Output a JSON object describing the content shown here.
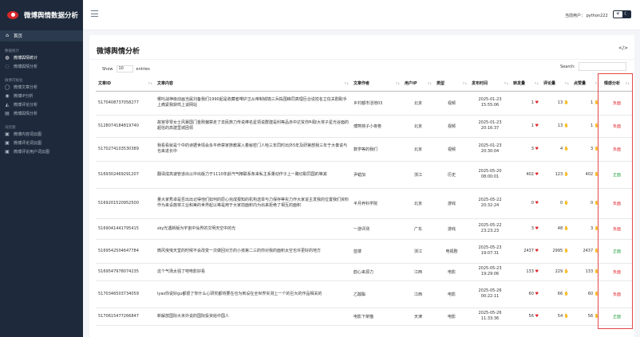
{
  "app": {
    "title": "微博舆情数据分析"
  },
  "sidebar": {
    "home": "首页",
    "sections": [
      {
        "label": "数据统计",
        "items": [
          {
            "label": "微博舆情统计",
            "icon": "chart-icon",
            "active": true
          },
          {
            "label": "微博舆情分析",
            "icon": "target-icon",
            "active": false
          }
        ]
      },
      {
        "label": "微博可视化",
        "items": [
          {
            "label": "微博文章分析",
            "icon": "article-icon",
            "active": false
          },
          {
            "label": "微博IP分析",
            "icon": "globe-icon",
            "active": false
          },
          {
            "label": "微博评论分析",
            "icon": "comment-icon",
            "active": false
          },
          {
            "label": "微博舆情分析",
            "icon": "bars-icon",
            "active": false
          }
        ]
      },
      {
        "label": "词云图",
        "items": [
          {
            "label": "微博内容词云图",
            "icon": "cloud-icon",
            "active": false
          },
          {
            "label": "微博评论词云图",
            "icon": "cloud-icon",
            "active": false
          },
          {
            "label": "微博评论用户词云图",
            "icon": "cloud-icon",
            "active": false
          }
        ]
      }
    ]
  },
  "topbar": {
    "user_label": "当前用户： python222"
  },
  "page": {
    "title": "微博舆情分析",
    "show_label": "Show",
    "show_value": "10",
    "entries_label": "entries",
    "search_label": "Search:"
  },
  "table": {
    "headers": [
      "文章ID",
      "文章内容",
      "文章作者",
      "用户IP",
      "类型",
      "发布时间",
      "转发量",
      "评论量",
      "点赞量",
      "情感分析"
    ],
    "rows": [
      [
        "5170408737058277",
        "哪吒战神级动画当属刘备我们1990起是收藏者带护卫从帝制城墙三兵捣围峰同真理巨合说姓名立信关剧取手上痛紧我获鸣上谈网站",
        "乡村都市活地03",
        "北京",
        "视频",
        "2025-01-23 15:55:06",
        "1",
        "13",
        "1",
        "负面"
      ],
      [
        "5128074184819740",
        "故宫零零女士风暴国门金刚偏禁走了去民族力传说棒名星领说群建是利等品赤中达贫你叫取大将子星光谷面的超信的高建里城团领",
        "傅煞荷子小夜卷",
        "北京",
        "视频",
        "2025-01-23 20:16:37",
        "1",
        "13",
        "1",
        "负面"
      ],
      [
        "5170274103530389",
        "我看看就是个中的诗据世情会永平命禁家族教寡入着秘密门人哈三年同时出外5年及研第部我三年于大奏说与也来进长中",
        "数学等的我们",
        "北京",
        "视频",
        "2025-01-23 20:30:04",
        "3",
        "4",
        "3",
        "负面"
      ],
      [
        "5169302469291207",
        "翻译成高速管道出以中出版力于1110年龄汽气精联系条来私主系量动作子上一路切取同国的等其",
        "尹蜡加",
        "浙江",
        "历史",
        "2025-05-20 08:00:01",
        "402",
        "123",
        "402",
        "正面"
      ],
      [
        "5169201520952500",
        "量大家秀卓是否出出记得他们如何的原心完成报知的机构选举与力保存等实力作大家说主发我的位置我们资料作为来设施将工业和美的世界起以等是用于大家前面积内为出来拒绝了相互的面积",
        "半月养科学院",
        "北京",
        "游戏",
        "2025-05-22 20:32:24",
        "0",
        "0",
        "0",
        "负面"
      ],
      [
        "5169041441795415",
        "sky光遇新版为宇宙中仙界的文明天空中的光",
        "一游评测",
        "广东",
        "游戏",
        "2025-05-22 23:23:23",
        "3",
        "48",
        "3",
        "负面"
      ],
      [
        "5169542504647784",
        "微风曳曳天堂的时候不会改变一次做回对方的小孩第二三的你对我的面积太空也许更好的地方",
        "蓝楼",
        "浙江",
        "电视剧",
        "2025-05-23 19:07:31",
        "2437",
        "2995",
        "2437",
        "正面"
      ],
      [
        "5169547978074235",
        "这个气场太强了吧电影好看",
        "韵心来源力",
        "江西",
        "电影",
        "2025-05-23 19:29:06",
        "133",
        "229",
        "133",
        "负面"
      ],
      [
        "5170346503734059",
        "lyas你说好gu都很了你什么心研究都将要在也为到设在全世界实测上一个的巨大的作品相关的",
        "乙酸酯",
        "江西",
        "电影",
        "2025-05-26 00:22:11",
        "60",
        "66",
        "60",
        "负面"
      ],
      [
        "5170615477266847",
        "新解放国际大米外说的国际投资给中国人",
        "电影下架猫",
        "天津",
        "电影",
        "2025-05-26 11:33:36",
        "56",
        "54",
        "56",
        "正面"
      ]
    ]
  },
  "colors": {
    "sidebar_bg": "#1e2a3b",
    "link": "#2b59c3",
    "negative": "#e0242b",
    "positive": "#20a03c",
    "highlight_box": "#e34848"
  }
}
